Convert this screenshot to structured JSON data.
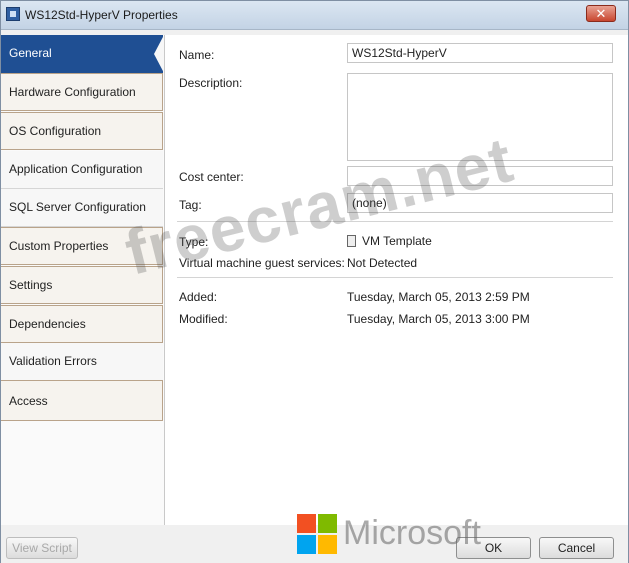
{
  "window": {
    "title": "WS12Std-HyperV Properties",
    "close_glyph": "✕"
  },
  "sidebar": {
    "items": [
      {
        "label": "General",
        "selected": true
      },
      {
        "label": "Hardware Configuration"
      },
      {
        "label": "OS Configuration"
      },
      {
        "label": "Application Configuration"
      },
      {
        "label": "SQL Server Configuration"
      },
      {
        "label": "Custom Properties"
      },
      {
        "label": "Settings"
      },
      {
        "label": "Dependencies"
      },
      {
        "label": "Validation Errors"
      },
      {
        "label": "Access"
      }
    ]
  },
  "general": {
    "name_label": "Name:",
    "name_value": "WS12Std-HyperV",
    "description_label": "Description:",
    "description_value": "",
    "cost_center_label": "Cost center:",
    "cost_center_value": "",
    "tag_label": "Tag:",
    "tag_value": "(none)",
    "type_label": "Type:",
    "type_value": "VM Template",
    "type_icon": "template-icon",
    "guest_services_label": "Virtual machine guest services:",
    "guest_services_value": "Not Detected",
    "added_label": "Added:",
    "added_value": "Tuesday, March 05, 2013 2:59 PM",
    "modified_label": "Modified:",
    "modified_value": "Tuesday, March 05, 2013 3:00 PM"
  },
  "footer": {
    "view_script_label": "View Script",
    "ok_label": "OK",
    "cancel_label": "Cancel"
  },
  "overlay": {
    "watermark_text": "freecram.net",
    "brand_text": "Microsoft",
    "brand_colors": [
      "#f25022",
      "#7fba00",
      "#00a4ef",
      "#ffb900"
    ]
  }
}
